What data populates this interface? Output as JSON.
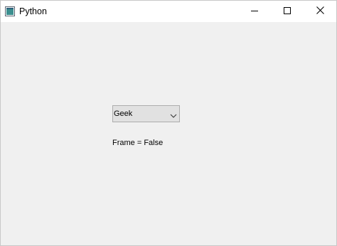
{
  "window": {
    "title": "Python",
    "app_icon": "python-window-icon",
    "controls": {
      "minimize_icon": "minimize-icon",
      "maximize_icon": "maximize-icon",
      "close_icon": "close-icon"
    }
  },
  "main": {
    "combo": {
      "selected": "Geek",
      "arrow_icon": "chevron-down-icon"
    },
    "status_label": "Frame = False"
  },
  "colors": {
    "client_background": "#f0f0f0",
    "titlebar_background": "#ffffff",
    "combo_background": "#e1e1e1",
    "combo_border": "#adadad"
  }
}
